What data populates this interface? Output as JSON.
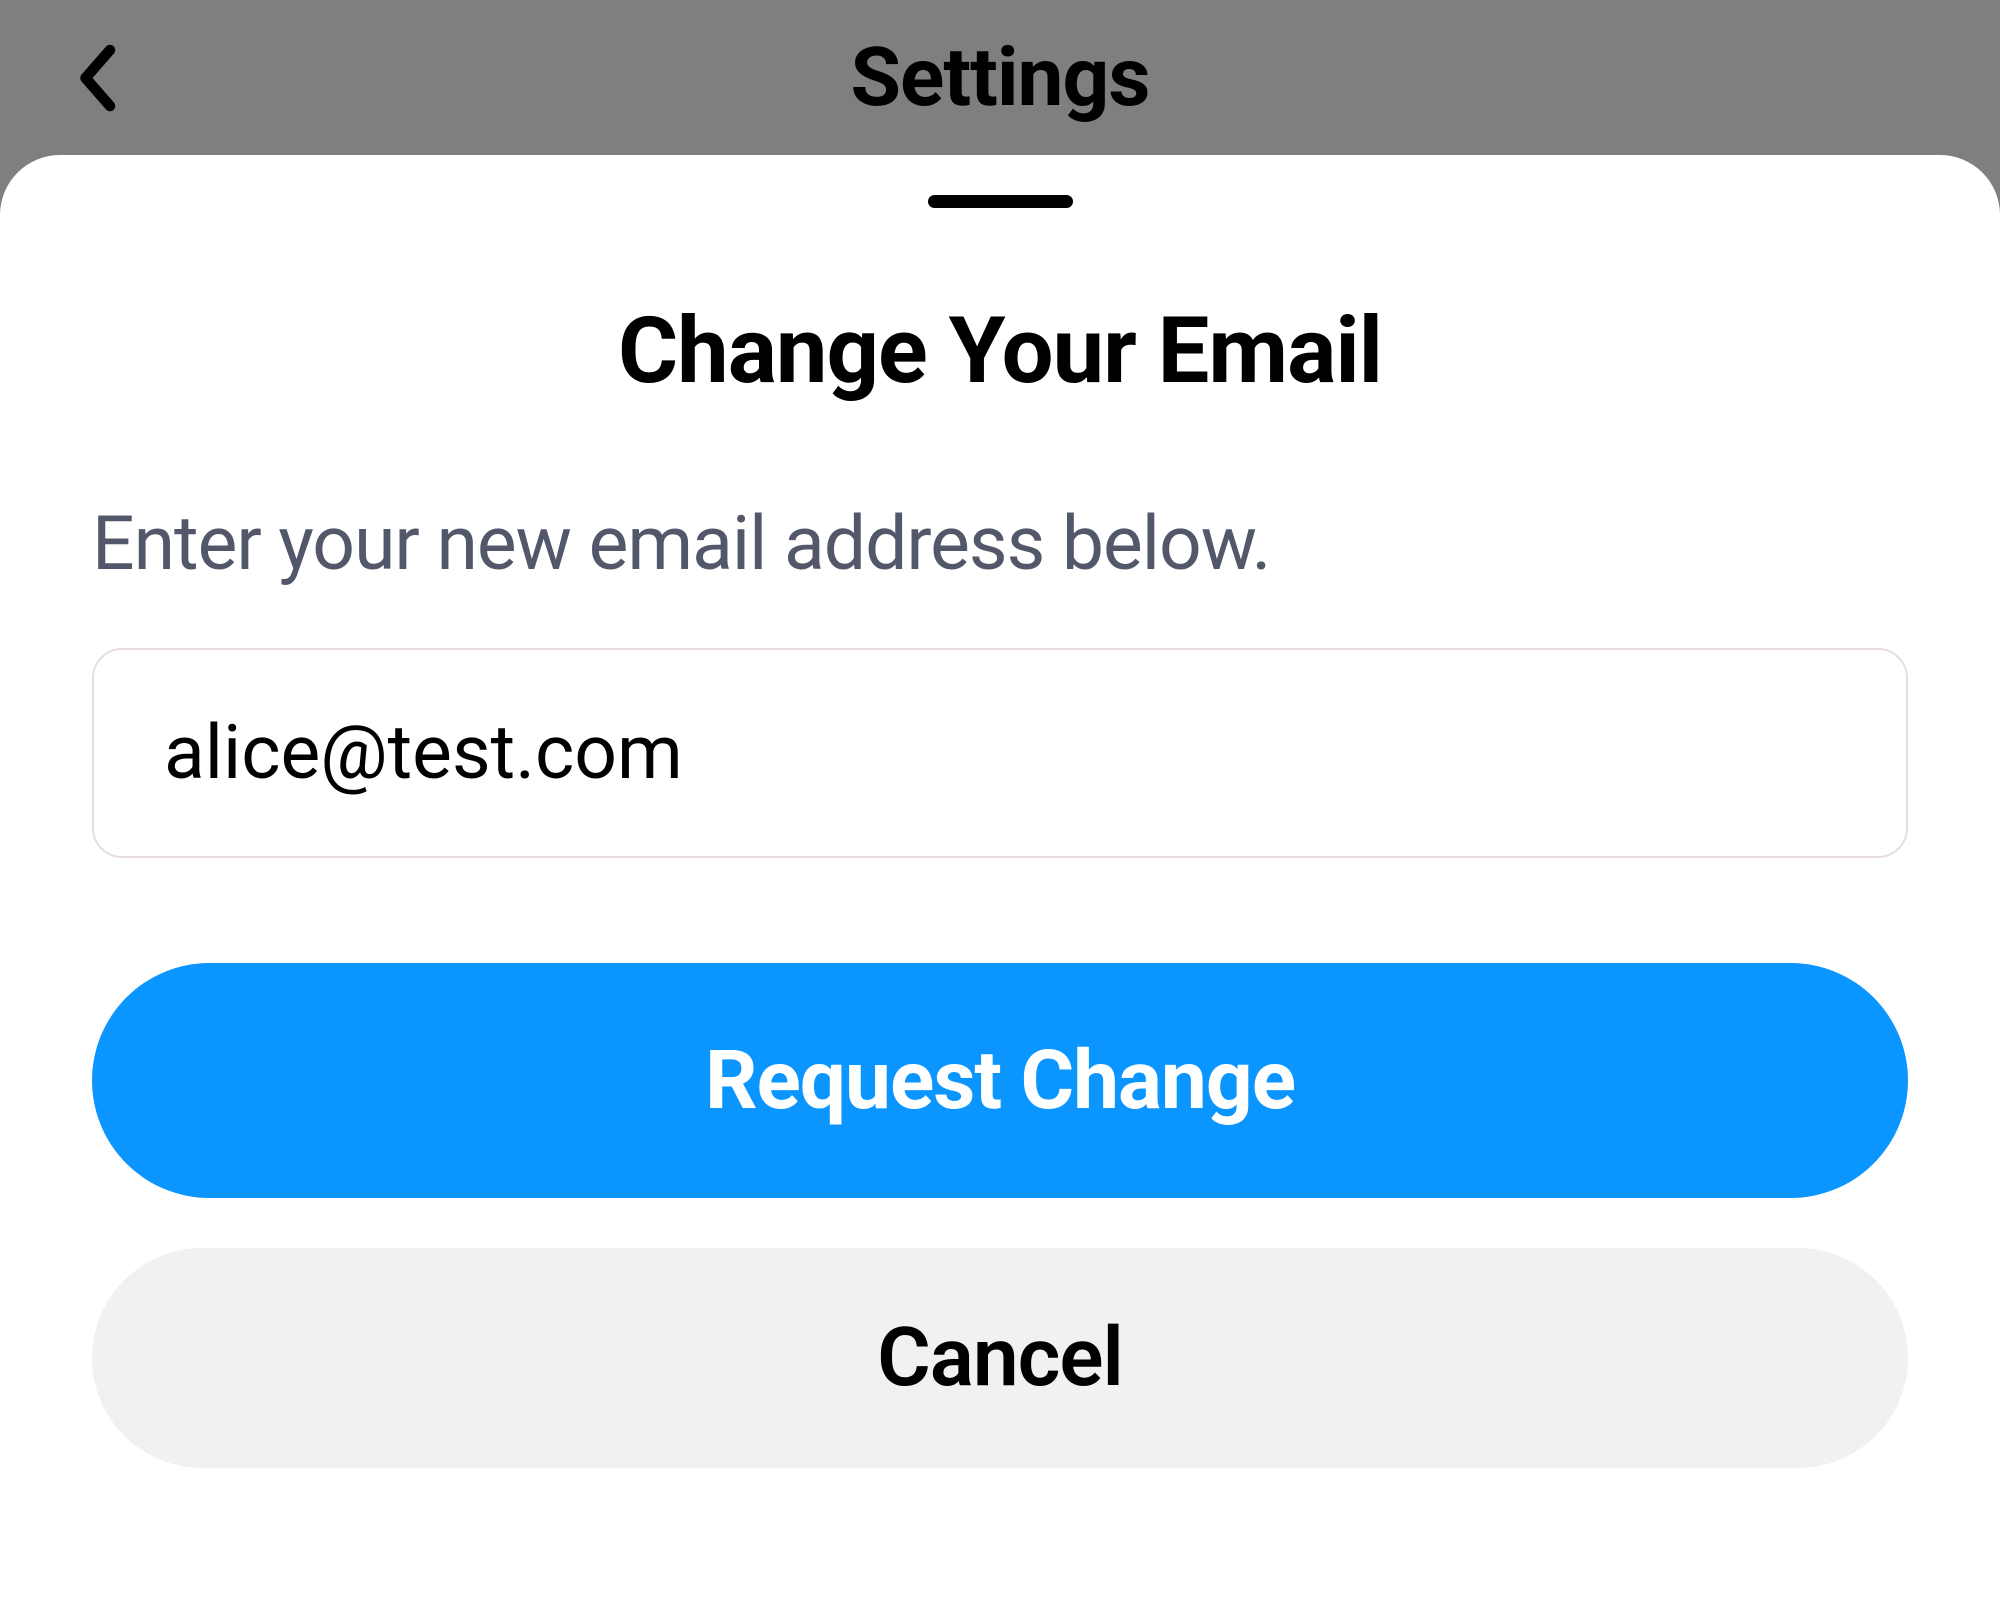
{
  "background": {
    "title": "Settings"
  },
  "sheet": {
    "title": "Change Your Email",
    "subtitle": "Enter your new email address below.",
    "email_value": "alice@test.com",
    "primary_label": "Request Change",
    "cancel_label": "Cancel"
  }
}
